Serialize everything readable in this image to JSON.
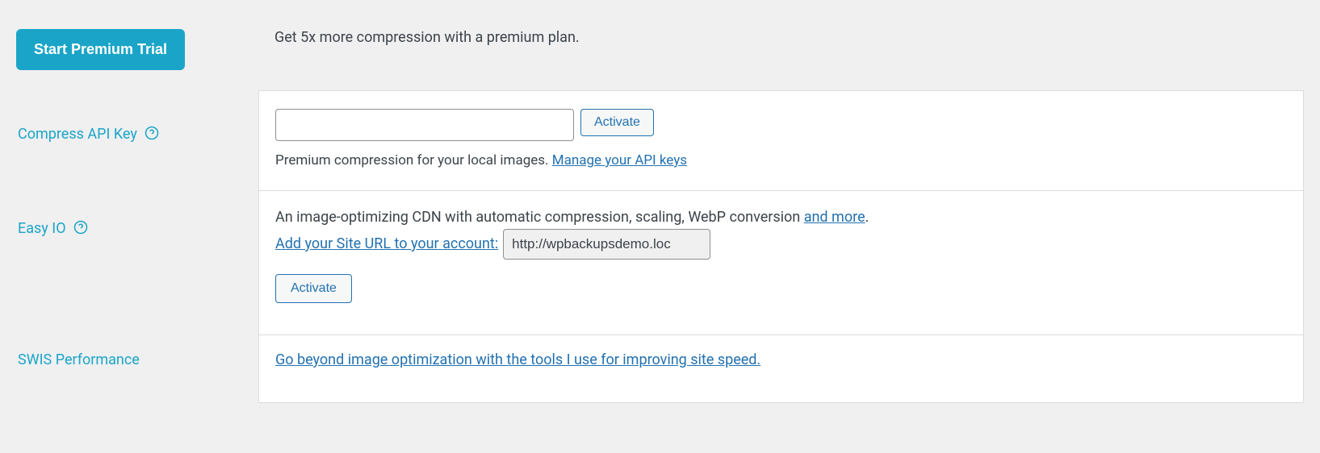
{
  "premium": {
    "button_label": "Start Premium Trial",
    "description": "Get 5x more compression with a premium plan."
  },
  "compress_api": {
    "label": "Compress API Key",
    "activate_label": "Activate",
    "description_prefix": "Premium compression for your local images. ",
    "manage_link": "Manage your API keys",
    "input_value": ""
  },
  "easy_io": {
    "label": "Easy IO",
    "description_prefix": "An image-optimizing CDN with automatic compression, scaling, WebP conversion ",
    "and_more_link": "and more",
    "description_suffix": ".",
    "add_url_link": "Add your Site URL to your account:",
    "url_value": "http://wpbackupsdemo.loc",
    "activate_label": "Activate"
  },
  "swis": {
    "label": "SWIS Performance",
    "link_text": "Go beyond image optimization with the tools I use for improving site speed."
  }
}
